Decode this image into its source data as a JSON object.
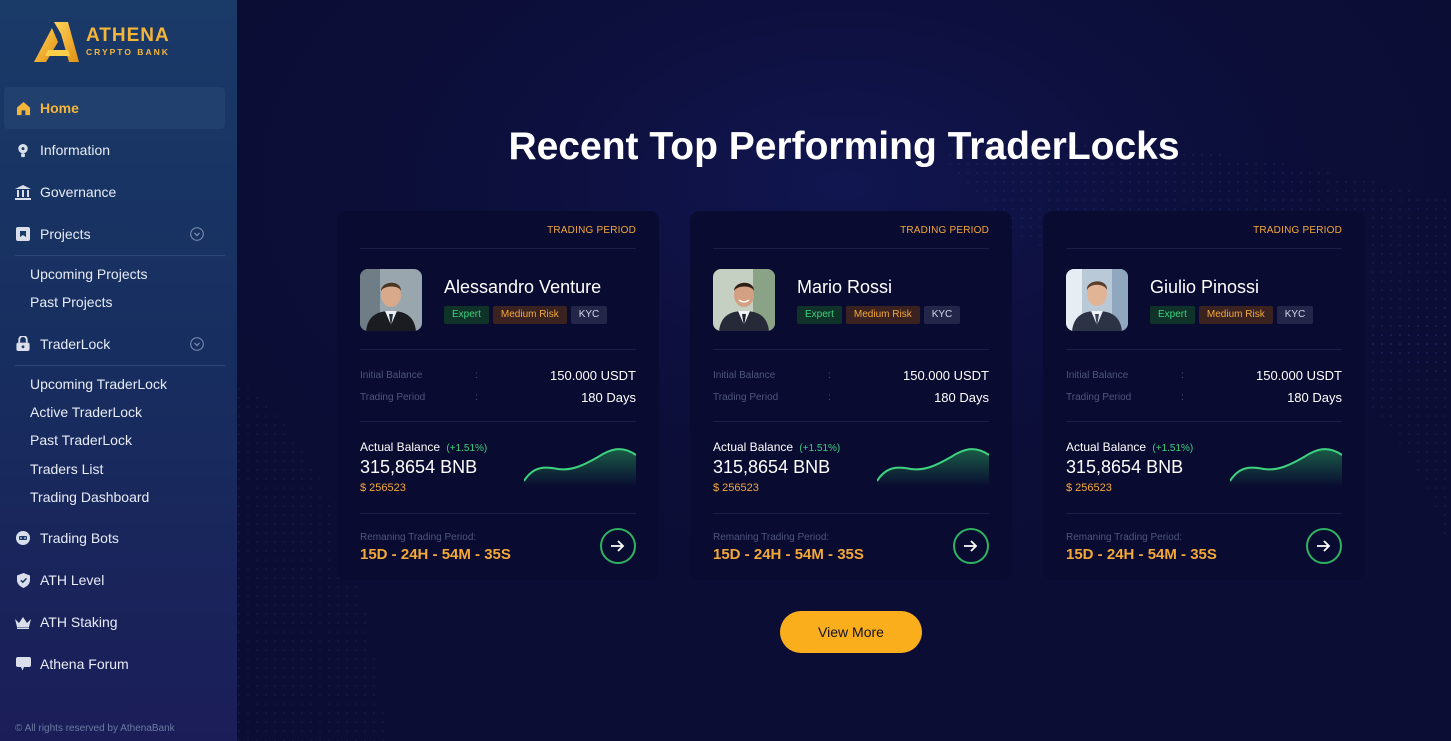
{
  "brand": {
    "name": "ATHENA",
    "tagline": "CRYPTO BANK"
  },
  "sidebar": {
    "items": [
      {
        "label": "Home",
        "icon": "home-icon",
        "active": true
      },
      {
        "label": "Information",
        "icon": "info-bulb-icon"
      },
      {
        "label": "Governance",
        "icon": "bank-icon"
      },
      {
        "label": "Projects",
        "icon": "projects-icon",
        "expandable": true,
        "children": [
          "Upcoming Projects",
          "Past Projects"
        ]
      },
      {
        "label": "TraderLock",
        "icon": "lock-icon",
        "expandable": true,
        "children": [
          "Upcoming TraderLock",
          "Active TraderLock",
          "Past TraderLock",
          "Traders List",
          "Trading Dashboard"
        ]
      },
      {
        "label": "Trading Bots",
        "icon": "bot-icon"
      },
      {
        "label": "ATH Level",
        "icon": "shield-icon"
      },
      {
        "label": "ATH Staking",
        "icon": "crown-icon"
      },
      {
        "label": "Athena Forum",
        "icon": "chat-icon"
      }
    ],
    "footer": "© All rights reserved by AthenaBank"
  },
  "main": {
    "title": "Recent Top Performing TraderLocks",
    "view_more": "View More",
    "cards": [
      {
        "period_header": "TRADING PERIOD",
        "name": "Alessandro Venture",
        "badges": {
          "expert": "Expert",
          "risk": "Medium Risk",
          "kyc": "KYC"
        },
        "initial_balance_label": "Initial Balance",
        "initial_balance": "150.000 USDT",
        "trading_period_label": "Trading Period",
        "trading_period": "180 Days",
        "colon": ":",
        "actual_balance_label": "Actual Balance",
        "actual_change": "(+1.51%)",
        "actual_bnb": "315,8654 BNB",
        "actual_usd": "$ 256523",
        "remaining_label": "Remaning Trading Period:",
        "remaining": "15D - 24H - 54M - 35S",
        "avatar": "avatar-icon"
      },
      {
        "period_header": "TRADING PERIOD",
        "name": "Mario Rossi",
        "badges": {
          "expert": "Expert",
          "risk": "Medium Risk",
          "kyc": "KYC"
        },
        "initial_balance_label": "Initial Balance",
        "initial_balance": "150.000 USDT",
        "trading_period_label": "Trading Period",
        "trading_period": "180 Days",
        "colon": ":",
        "actual_balance_label": "Actual Balance",
        "actual_change": "(+1.51%)",
        "actual_bnb": "315,8654 BNB",
        "actual_usd": "$ 256523",
        "remaining_label": "Remaning Trading Period:",
        "remaining": "15D - 24H - 54M - 35S",
        "avatar": "avatar-icon"
      },
      {
        "period_header": "TRADING PERIOD",
        "name": "Giulio Pinossi",
        "badges": {
          "expert": "Expert",
          "risk": "Medium Risk",
          "kyc": "KYC"
        },
        "initial_balance_label": "Initial Balance",
        "initial_balance": "150.000 USDT",
        "trading_period_label": "Trading Period",
        "trading_period": "180 Days",
        "colon": ":",
        "actual_balance_label": "Actual Balance",
        "actual_change": "(+1.51%)",
        "actual_bnb": "315,8654 BNB",
        "actual_usd": "$ 256523",
        "remaining_label": "Remaning Trading Period:",
        "remaining": "15D - 24H - 54M - 35S",
        "avatar": "avatar-icon"
      }
    ]
  },
  "colors": {
    "accent": "#f4b63a",
    "background": "#0b0d35",
    "positive": "#3ed17e",
    "button": "#fbae1c"
  }
}
